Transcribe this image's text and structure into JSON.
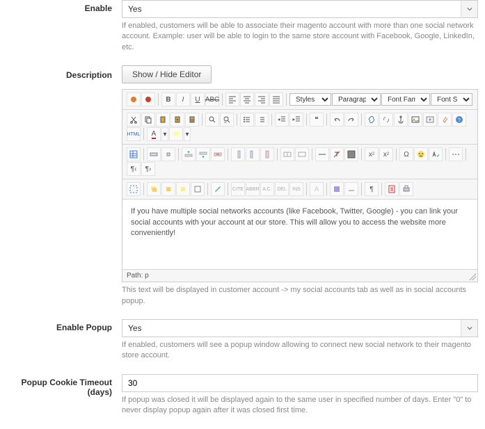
{
  "enable": {
    "label": "Enable",
    "value": "Yes",
    "help": "If enabled, customers will be able to associate their magento account with more than one social network account. Example: user will be able to login to the same store account with Facebook, Google, LinkedIn, etc."
  },
  "description": {
    "label": "Description",
    "toggle_button": "Show / Hide Editor",
    "styles_label": "Styles",
    "paragraph_label": "Paragraph",
    "font_family_label": "Font Family",
    "font_size_label": "Font Size",
    "body": "If you have multiple social networks accounts (like Facebook, Twitter, Google) - you can link your social accounts with your account at our store. This will allow you to access the website more conveniently!",
    "path": "Path: p",
    "help": "This text will be displayed in customer account -> my social accounts tab as well as in social accounts popup."
  },
  "enable_popup": {
    "label": "Enable Popup",
    "value": "Yes",
    "help": "If enabled, customers will see a popup window allowing to connect new social network to their magento store account."
  },
  "cookie_timeout": {
    "label": "Popup Cookie Timeout (days)",
    "value": "30",
    "help": "If popup was closed it will be displayed again to the same user in specified number of days. Enter \"0\" to never display popup again after it was closed first time."
  }
}
